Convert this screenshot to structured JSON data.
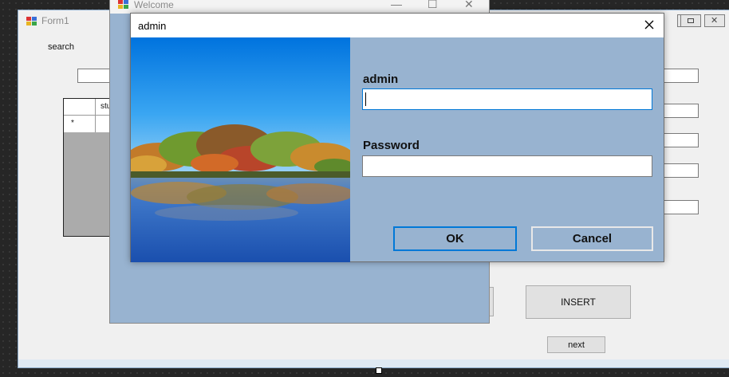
{
  "form1": {
    "title": "Form1",
    "search_label": "search",
    "grid_column": "stu",
    "new_row_marker": "*",
    "insert_label": "INSERT",
    "next_label": "next"
  },
  "welcome": {
    "title": "Welcome",
    "minimize_glyph": "—",
    "maximize_glyph": "☐",
    "close_glyph": "✕"
  },
  "dialog": {
    "title": "admin",
    "username_label": "admin",
    "username_value": "",
    "password_label": "Password",
    "password_value": "",
    "ok_label": "OK",
    "cancel_label": "Cancel",
    "picture": "lake-autumn-landscape"
  },
  "colors": {
    "dialog_bg": "#98b3d0",
    "focus_border": "#0078d7",
    "sky_top": "#0077e0",
    "water": "#2f6fd1"
  }
}
